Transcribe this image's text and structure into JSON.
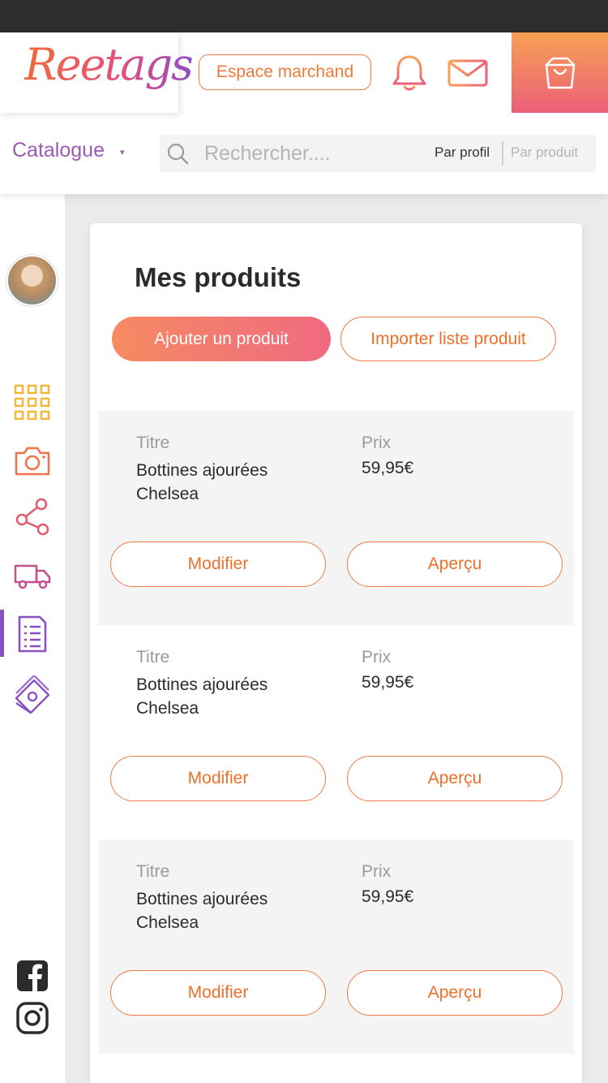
{
  "header": {
    "logo_text": "Reetags",
    "merchant_button": "Espace marchand",
    "icons": [
      "bell-icon",
      "mail-icon",
      "shopping-bag-icon"
    ]
  },
  "search": {
    "catalogue_label": "Catalogue",
    "caret": "▾",
    "placeholder": "Rechercher....",
    "by_profile": "Par profil",
    "by_product": "Par produit"
  },
  "sidebar": {
    "items": [
      "grid-icon",
      "camera-icon",
      "share-icon",
      "delivery-truck-icon",
      "document-list-icon",
      "money-icon"
    ],
    "active": "document-list-icon",
    "social": [
      "facebook-icon",
      "instagram-icon"
    ]
  },
  "main": {
    "title": "Mes produits",
    "add_button": "Ajouter un produit",
    "import_button": "Importer liste produit",
    "products": [
      {
        "title_label": "Titre",
        "title": "Bottines ajourées Chelsea",
        "price_label": "Prix",
        "price": "59,95€",
        "edit": "Modifier",
        "preview": "Aperçu"
      },
      {
        "title_label": "Titre",
        "title": "Bottines ajourées Chelsea",
        "price_label": "Prix",
        "price": "59,95€",
        "edit": "Modifier",
        "preview": "Aperçu"
      },
      {
        "title_label": "Titre",
        "title": "Bottines ajourées Chelsea",
        "price_label": "Prix",
        "price": "59,95€",
        "edit": "Modifier",
        "preview": "Aperçu"
      }
    ]
  },
  "colors": {
    "accent_orange": "#ee7a4a",
    "accent_pink": "#ec5f79",
    "accent_purple": "#9b59b6",
    "status_bar": "#2d2d2d"
  }
}
